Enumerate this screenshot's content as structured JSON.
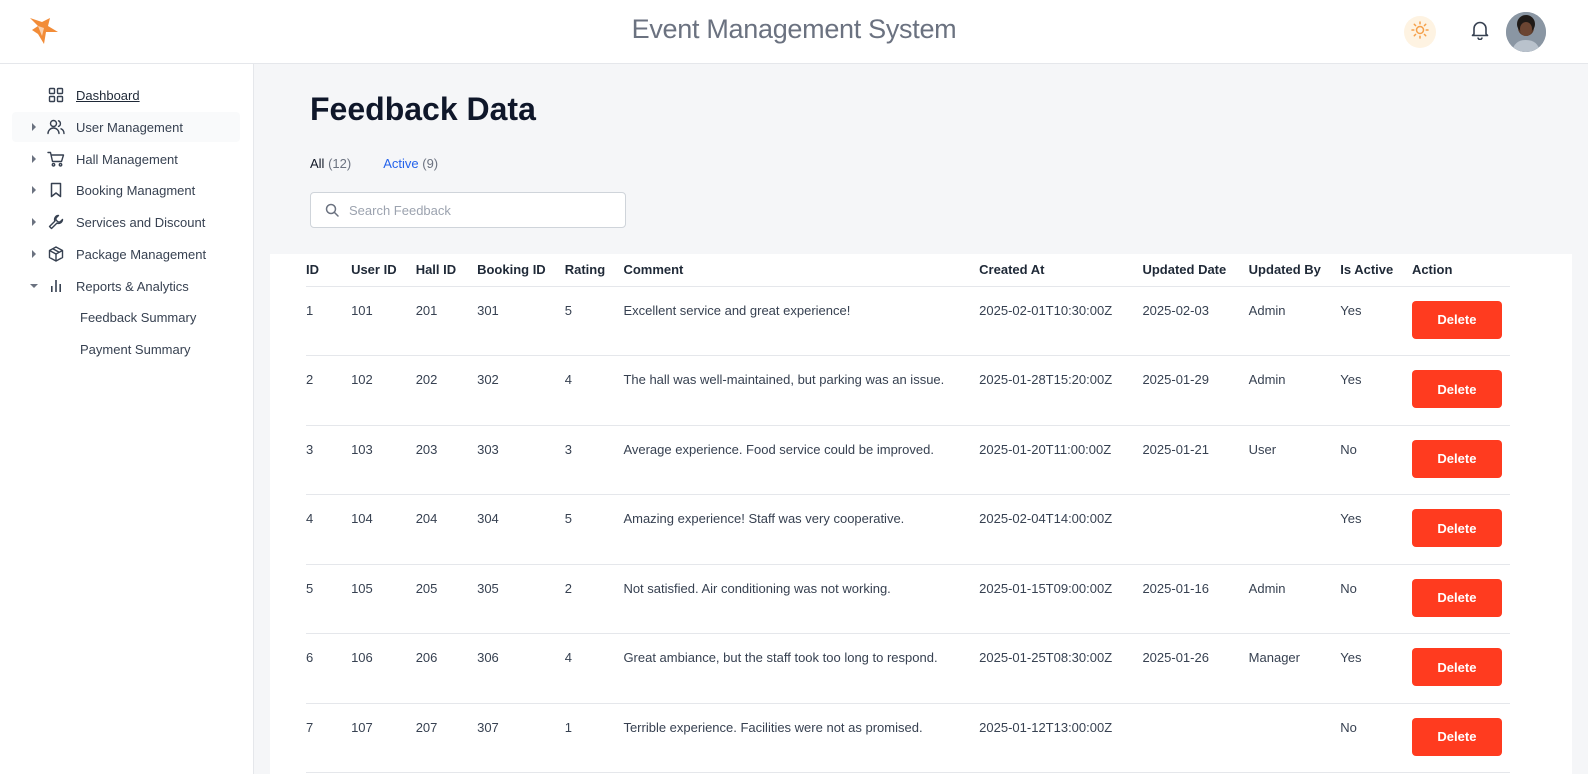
{
  "header": {
    "title": "Event Management System",
    "logo_icon": "fox-logo",
    "theme_icon": "sun-icon",
    "notification_icon": "bell-icon",
    "accent_color": "#f5a04a"
  },
  "sidebar": {
    "items": [
      {
        "label": "Dashboard",
        "icon": "grid-icon",
        "expandable": false,
        "active": true
      },
      {
        "label": "User Management",
        "icon": "users-icon",
        "expandable": true
      },
      {
        "label": "Hall Management",
        "icon": "cart-icon",
        "expandable": true
      },
      {
        "label": "Booking Managment",
        "icon": "bookmark-icon",
        "expandable": true
      },
      {
        "label": "Services and Discount",
        "icon": "wrench-icon",
        "expandable": true
      },
      {
        "label": "Package Management",
        "icon": "box-icon",
        "expandable": true
      },
      {
        "label": "Reports & Analytics",
        "icon": "bar-chart-icon",
        "expandable": true,
        "expanded": true
      }
    ],
    "sub_items": [
      {
        "label": "Feedback Summary"
      },
      {
        "label": "Payment Summary"
      }
    ]
  },
  "main": {
    "title": "Feedback Data",
    "tabs": [
      {
        "label": "All",
        "count": "(12)"
      },
      {
        "label": "Active",
        "count": "(9)"
      }
    ],
    "search": {
      "placeholder": "Search Feedback",
      "value": ""
    },
    "table": {
      "columns": [
        "ID",
        "User ID",
        "Hall ID",
        "Booking ID",
        "Rating",
        "Comment",
        "Created At",
        "Updated Date",
        "Updated By",
        "Is Active",
        "Action"
      ],
      "rows": [
        [
          "1",
          "101",
          "201",
          "301",
          "5",
          "Excellent service and great experience!",
          "2025-02-01T10:30:00Z",
          "2025-02-03",
          "Admin",
          "Yes",
          "Delete"
        ],
        [
          "2",
          "102",
          "202",
          "302",
          "4",
          "The hall was well-maintained, but parking was an issue.",
          "2025-01-28T15:20:00Z",
          "2025-01-29",
          "Admin",
          "Yes",
          "Delete"
        ],
        [
          "3",
          "103",
          "203",
          "303",
          "3",
          "Average experience. Food service could be improved.",
          "2025-01-20T11:00:00Z",
          "2025-01-21",
          "User",
          "No",
          "Delete"
        ],
        [
          "4",
          "104",
          "204",
          "304",
          "5",
          "Amazing experience! Staff was very cooperative.",
          "2025-02-04T14:00:00Z",
          "",
          "",
          "Yes",
          "Delete"
        ],
        [
          "5",
          "105",
          "205",
          "305",
          "2",
          "Not satisfied. Air conditioning was not working.",
          "2025-01-15T09:00:00Z",
          "2025-01-16",
          "Admin",
          "No",
          "Delete"
        ],
        [
          "6",
          "106",
          "206",
          "306",
          "4",
          "Great ambiance, but the staff took too long to respond.",
          "2025-01-25T08:30:00Z",
          "2025-01-26",
          "Manager",
          "Yes",
          "Delete"
        ],
        [
          "7",
          "107",
          "207",
          "307",
          "1",
          "Terrible experience. Facilities were not as promised.",
          "2025-01-12T13:00:00Z",
          "",
          "",
          "No",
          "Delete"
        ]
      ]
    },
    "delete_color": "#ff3b1f",
    "active_tab_color": "#2563eb"
  }
}
